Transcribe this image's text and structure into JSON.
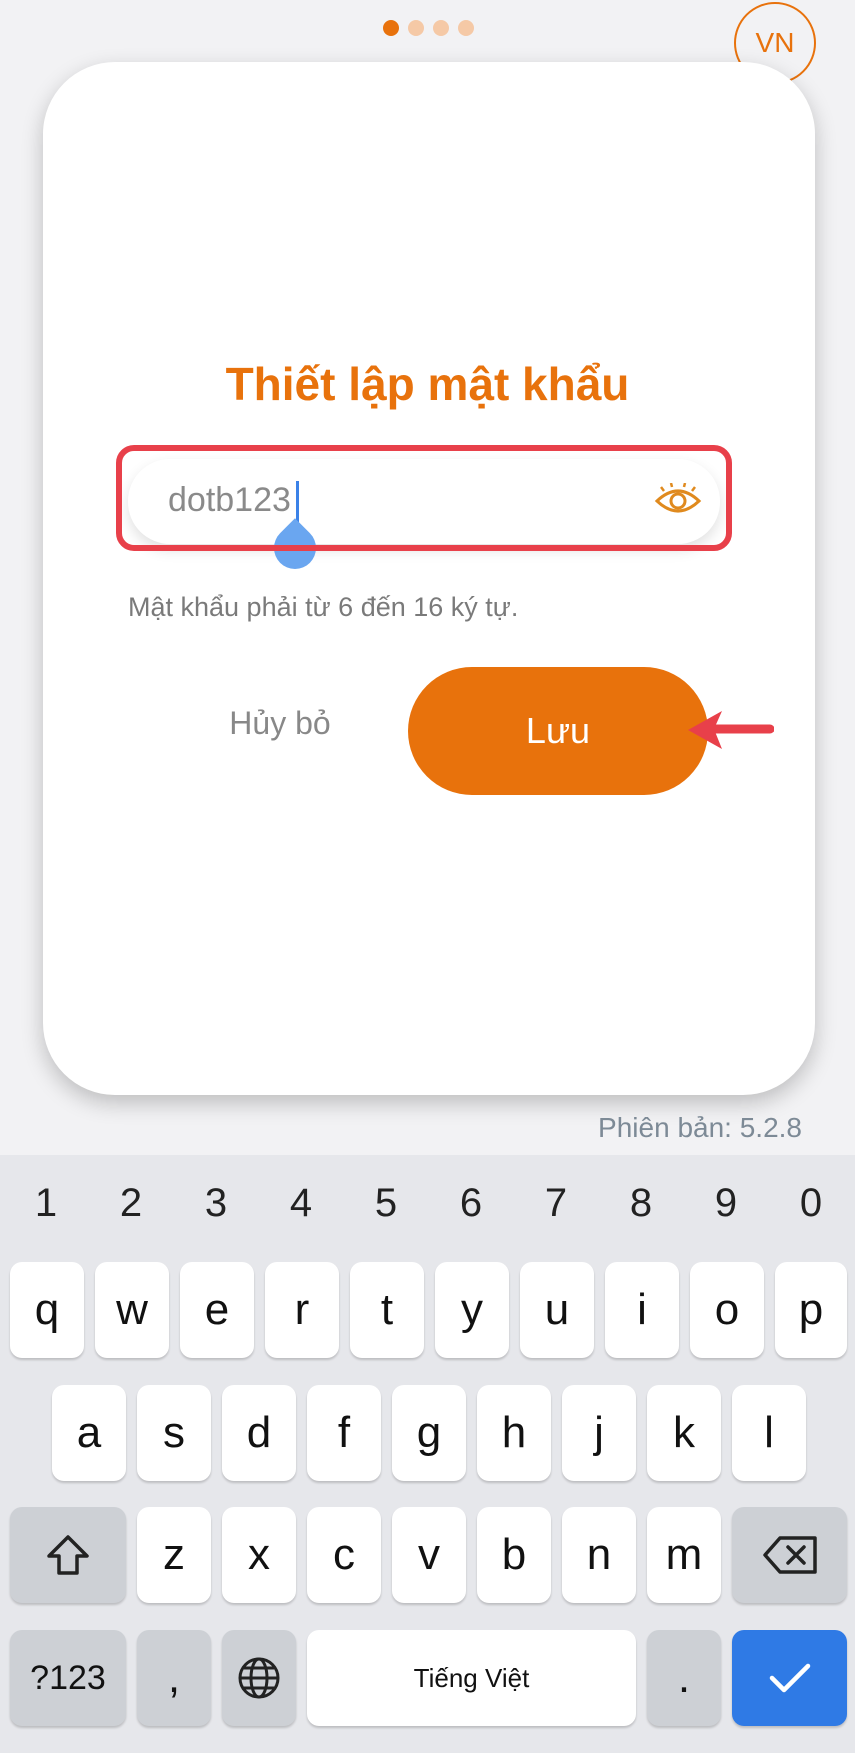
{
  "header": {
    "lang_label": "VN"
  },
  "dialog": {
    "title": "Thiết lập mật khẩu",
    "password_value": "dotb123",
    "hint": "Mật khẩu phải từ 6 đến 16 ký tự.",
    "cancel_label": "Hủy bỏ",
    "save_label": "Lưu"
  },
  "version": "Phiên bản: 5.2.8",
  "keyboard": {
    "numbers": [
      "1",
      "2",
      "3",
      "4",
      "5",
      "6",
      "7",
      "8",
      "9",
      "0"
    ],
    "row1": [
      "q",
      "w",
      "e",
      "r",
      "t",
      "y",
      "u",
      "i",
      "o",
      "p"
    ],
    "row2": [
      "a",
      "s",
      "d",
      "f",
      "g",
      "h",
      "j",
      "k",
      "l"
    ],
    "row3": [
      "z",
      "x",
      "c",
      "v",
      "b",
      "n",
      "m"
    ],
    "mode_label": "?123",
    "comma": ",",
    "space_label": "Tiếng Việt",
    "period": "."
  },
  "colors": {
    "accent": "#e8720c",
    "highlight": "#e8404a",
    "key_blue": "#2f7ae5"
  }
}
